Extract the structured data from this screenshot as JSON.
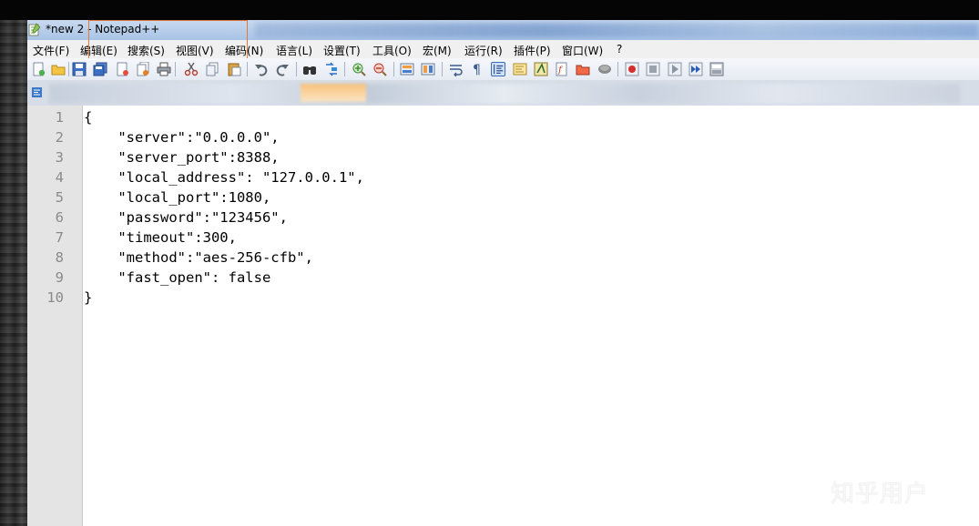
{
  "window": {
    "title": "*new 2 - Notepad++"
  },
  "menu": [
    {
      "label": "文件(F)"
    },
    {
      "label": "编辑(E)"
    },
    {
      "label": "搜索(S)"
    },
    {
      "label": "视图(V)"
    },
    {
      "label": "编码(N)"
    },
    {
      "label": "语言(L)"
    },
    {
      "label": "设置(T)"
    },
    {
      "label": "工具(O)"
    },
    {
      "label": "宏(M)"
    },
    {
      "label": "运行(R)"
    },
    {
      "label": "插件(P)"
    },
    {
      "label": "窗口(W)"
    },
    {
      "label": "?"
    }
  ],
  "toolbar": {
    "icons": [
      "new-file-icon",
      "open-file-icon",
      "save-icon",
      "save-all-icon",
      "close-icon",
      "close-all-icon",
      "print-icon",
      "cut-icon",
      "copy-icon",
      "paste-icon",
      "undo-icon",
      "redo-icon",
      "find-icon",
      "replace-icon",
      "zoom-in-icon",
      "zoom-out-icon",
      "sync-vertical-icon",
      "sync-horizontal-icon",
      "word-wrap-icon",
      "show-all-chars-icon",
      "indent-guide-icon",
      "doc-map-icon",
      "function-list-icon",
      "folder-as-workspace-icon",
      "doc-list-icon",
      "monitoring-icon",
      "record-macro-icon",
      "stop-macro-icon",
      "play-macro-icon",
      "run-macro-multiple-icon",
      "save-macro-icon"
    ]
  },
  "editor": {
    "lines": [
      "{",
      "    \"server\":\"0.0.0.0\",",
      "    \"server_port\":8388,",
      "    \"local_address\": \"127.0.0.1\",",
      "    \"local_port\":1080,",
      "    \"password\":\"123456\",",
      "    \"timeout\":300,",
      "    \"method\":\"aes-256-cfb\",",
      "    \"fast_open\": false",
      "}"
    ],
    "line_numbers": [
      "1",
      "2",
      "3",
      "4",
      "5",
      "6",
      "7",
      "8",
      "9",
      "10"
    ],
    "current_line": 9
  },
  "watermark": "知乎用户",
  "colors": {
    "current_line": "#e8e8ff",
    "gutter": "#e4e4e4",
    "highlight_box": "#e07a3a"
  }
}
